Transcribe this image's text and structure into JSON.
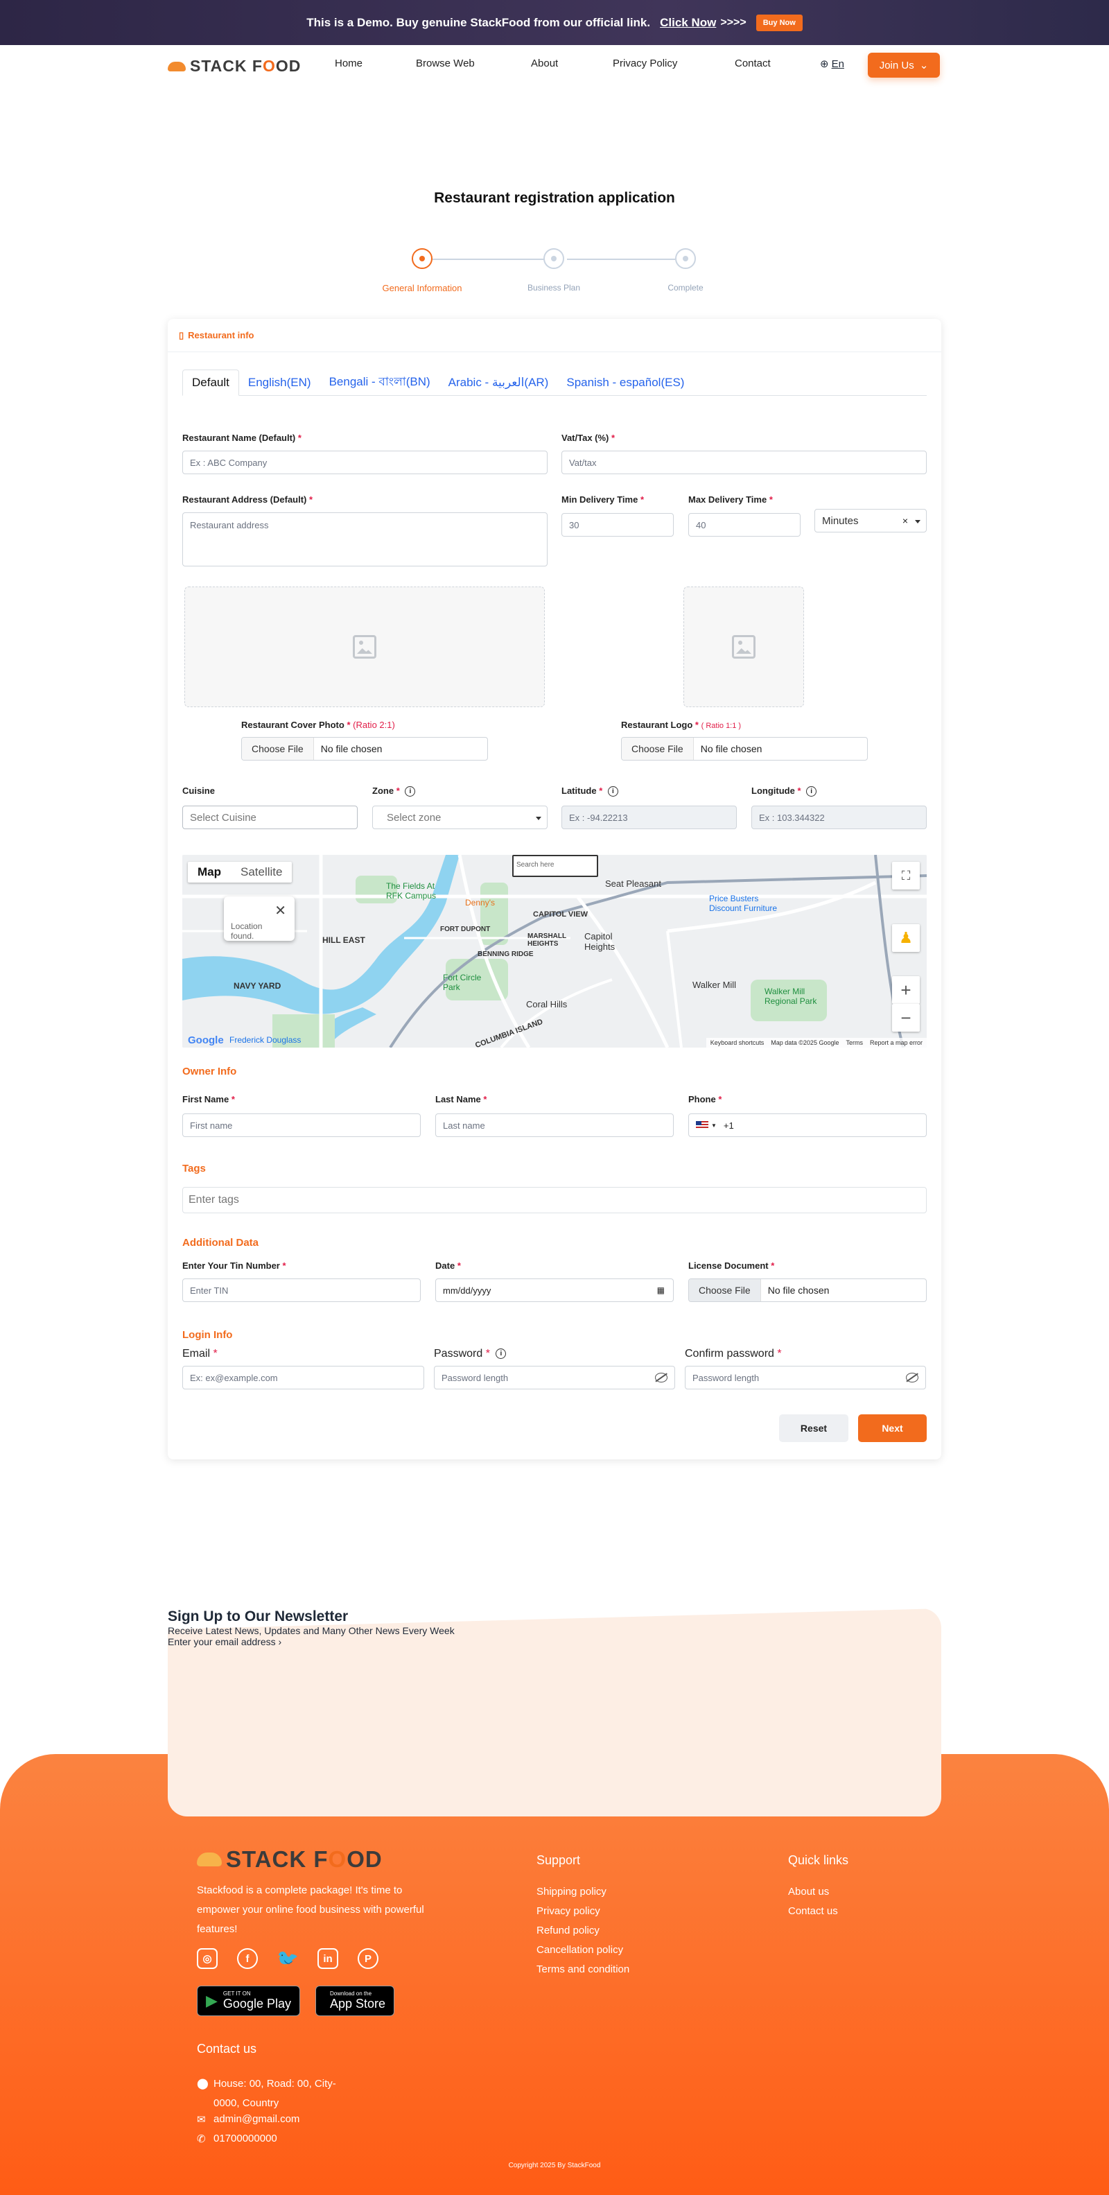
{
  "banner": {
    "message": "This is a Demo. Buy genuine StackFood from our official link.",
    "click": "Click Now",
    "arrows": ">>>>",
    "buy": "Buy Now"
  },
  "nav": {
    "logo_pre": "STACK F",
    "logo_o": "O",
    "logo_post": "OD",
    "links": [
      "Home",
      "Browse Web",
      "About",
      "Privacy Policy",
      "Contact"
    ],
    "lang": "En",
    "join": "Join Us"
  },
  "page": {
    "title": "Restaurant registration application"
  },
  "steps": [
    "General Information",
    "Business Plan",
    "Complete"
  ],
  "card": {
    "heading": "Restaurant info"
  },
  "tabs": [
    "Default",
    "English(EN)",
    "Bengali - বাংলা(BN)",
    "Arabic - العربية(AR)",
    "Spanish - español(ES)"
  ],
  "form": {
    "name_label": "Restaurant Name (Default)",
    "name_ph": "Ex : ABC Company",
    "vat_label": "Vat/Tax (%)",
    "vat_ph": "Vat/tax",
    "address_label": "Restaurant Address (Default)",
    "address_ph": "Restaurant address",
    "min_label": "Min Delivery Time",
    "min_ph": "30",
    "max_label": "Max Delivery Time",
    "max_ph": "40",
    "unit": "Minutes",
    "cover_label": "Restaurant Cover Photo",
    "cover_ratio": "(Ratio 2:1)",
    "logo_label": "Restaurant Logo",
    "logo_ratio": "( Ratio 1:1 )",
    "choose": "Choose File",
    "no_file": "No file chosen",
    "cuisine_label": "Cuisine",
    "cuisine_ph": "Select Cuisine",
    "zone_label": "Zone",
    "zone_ph": "Select zone",
    "lat_label": "Latitude",
    "lat_ph": "Ex : -94.22213",
    "lng_label": "Longitude",
    "lng_ph": "Ex : 103.344322"
  },
  "map": {
    "map": "Map",
    "satellite": "Satellite",
    "search_ph": "Search here",
    "popup": "Location found.",
    "labels": [
      "The Fields At RFK Campus",
      "Denny's",
      "Seat Pleasant",
      "Price Busters Discount Furniture",
      "HILL EAST",
      "CAPITOL VIEW",
      "Capitol Heights",
      "MARSHALL HEIGHTS",
      "BENNING RIDGE",
      "FORT DUPONT",
      "Fort Circle Park",
      "Coral Hills",
      "Walker Mill",
      "Walker Mill Regional Park",
      "NAVY YARD",
      "Frederick Douglass",
      "COLUMBIA ISLAND"
    ],
    "footer": [
      "Keyboard shortcuts",
      "Map data ©2025 Google",
      "Terms",
      "Report a map error"
    ],
    "google": "Google"
  },
  "owner": {
    "section": "Owner Info",
    "first_label": "First Name",
    "first_ph": "First name",
    "last_label": "Last Name",
    "last_ph": "Last name",
    "phone_label": "Phone",
    "phone_code": "+1"
  },
  "tags": {
    "section": "Tags",
    "ph": "Enter tags"
  },
  "additional": {
    "section": "Additional Data",
    "tin_label": "Enter Your Tin Number",
    "tin_ph": "Enter TIN",
    "date_label": "Date",
    "date_ph": "mm/dd/yyyy",
    "license_label": "License Document"
  },
  "login": {
    "section": "Login Info",
    "email_label": "Email",
    "email_ph": "Ex: ex@example.com",
    "pw_label": "Password",
    "pw_ph": "Password length",
    "cpw_label": "Confirm password",
    "cpw_ph": "Password length"
  },
  "actions": {
    "reset": "Reset",
    "next": "Next"
  },
  "newsletter": {
    "title": "Sign Up to Our Newsletter",
    "text": "Receive Latest News, Updates and Many Other News Every Week",
    "ph": "Enter your email address"
  },
  "footer": {
    "desc": "Stackfood is a complete package! It's time to empower your online food business with powerful features!",
    "google_small": "GET IT ON",
    "google": "Google Play",
    "apple_small": "Download on the",
    "apple": "App Store",
    "support_title": "Support",
    "support": [
      "Shipping policy",
      "Privacy policy",
      "Refund policy",
      "Cancellation policy",
      "Terms and condition"
    ],
    "quick_title": "Quick links",
    "quick": [
      "About us",
      "Contact us"
    ],
    "contact_title": "Contact us",
    "address": "House: 00, Road: 00, City-0000, Country",
    "email": "admin@gmail.com",
    "phone": "01700000000",
    "copyright": "Copyright 2025 By StackFood"
  }
}
